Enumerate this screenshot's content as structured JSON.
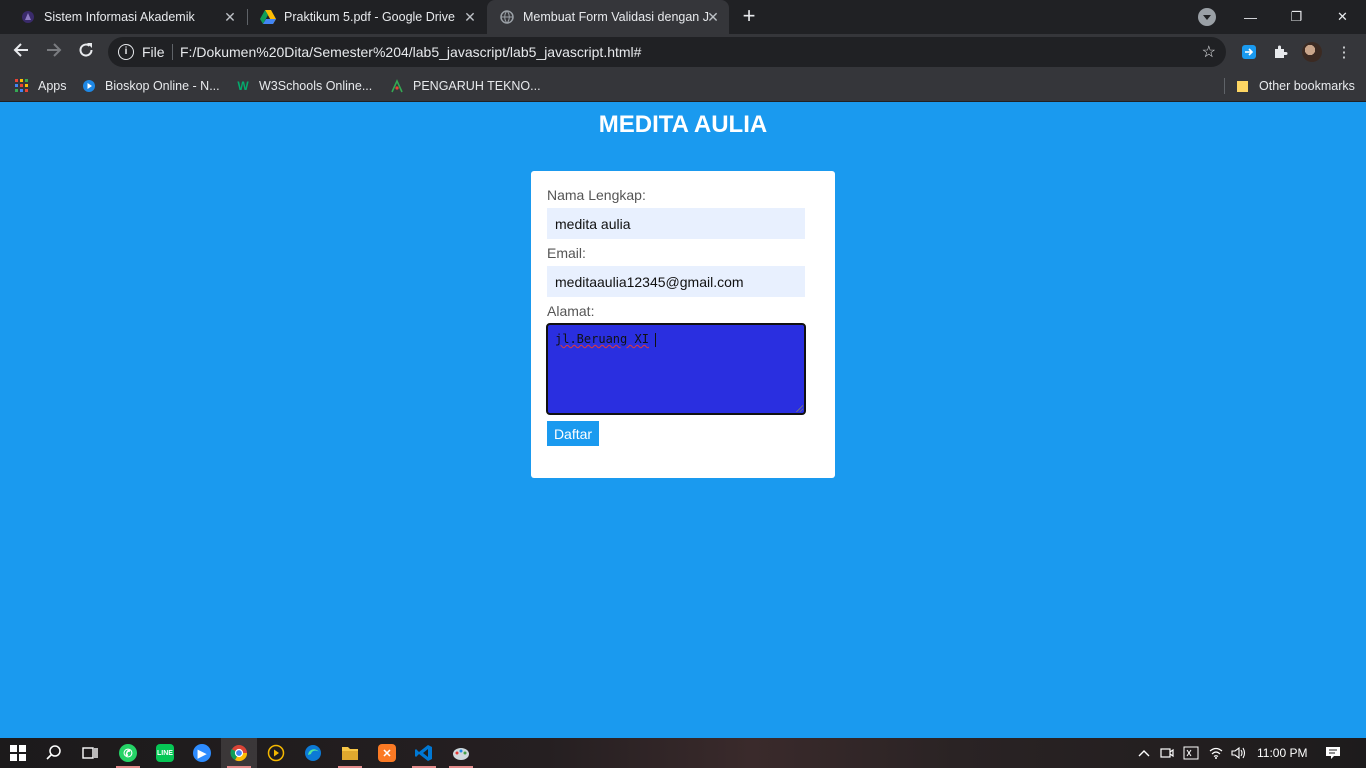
{
  "browser": {
    "tabs": [
      {
        "title": "Sistem Informasi Akademik",
        "icon": "siakad-icon"
      },
      {
        "title": "Praktikum 5.pdf - Google Drive",
        "icon": "google-drive-icon"
      },
      {
        "title": "Membuat Form Validasi dengan J",
        "icon": "globe-icon",
        "active": true
      }
    ],
    "omnibox": {
      "scheme_label": "File",
      "url": "F:/Dokumen%20Dita/Semester%204/lab5_javascript/lab5_javascript.html#"
    },
    "bookmarks": [
      {
        "label": "Apps",
        "icon": "apps-grid-icon"
      },
      {
        "label": "Bioskop Online - N...",
        "icon": "bioskop-icon"
      },
      {
        "label": "W3Schools Online...",
        "icon": "w3schools-icon"
      },
      {
        "label": "PENGARUH TEKNO...",
        "icon": "ppt-icon"
      }
    ],
    "other_bookmarks": "Other bookmarks"
  },
  "page": {
    "title": "MEDITA AULIA",
    "form": {
      "nama_label": "Nama Lengkap:",
      "nama_value": "medita aulia",
      "email_label": "Email:",
      "email_value": "meditaaulia12345@gmail.com",
      "alamat_label": "Alamat:",
      "alamat_value": "jl.Beruang XI",
      "submit_label": "Daftar"
    }
  },
  "taskbar": {
    "apps": [
      "whatsapp",
      "line",
      "zoom",
      "chrome",
      "media-player",
      "edge",
      "file-explorer",
      "xampp",
      "vscode",
      "paint"
    ],
    "clock": "11:00 PM"
  },
  "colors": {
    "page_bg": "#1a9aef",
    "textarea_bg": "#2a2fe0",
    "autofill_bg": "#e8f0fe"
  }
}
